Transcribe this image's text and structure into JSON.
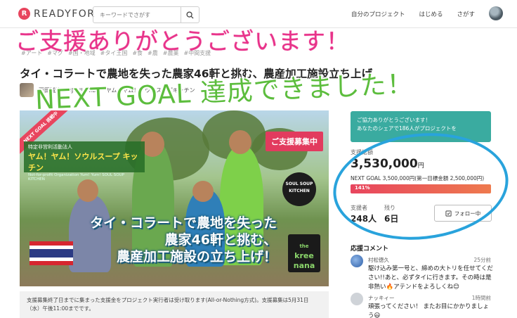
{
  "header": {
    "logo_mark": "R",
    "logo_text": "READYFOR",
    "search_placeholder": "キーワードでさがす",
    "nav_my_projects": "自分のプロジェクト",
    "nav_start": "はじめる",
    "nav_explore": "さがす"
  },
  "tags": [
    "#アート",
    "#マグ",
    "#国・地域",
    "#タイ王国",
    "#食",
    "#農",
    "#農業",
    "#中間支援"
  ],
  "project": {
    "title": "タイ・コラートで農地を失った農家46軒と挑む、農産加工施設立ち上げ",
    "owner": "西田誠治 SEIJI NISHIDA・ヤム！ヤム！ソウルスープキッチン"
  },
  "hero": {
    "ribbon": "NEXT GOAL 挑戦中",
    "org_line1": "特定非営利活動法人",
    "org_line2": "ヤム！ヤム！ソウルスープ キッチン",
    "org_line3": "Not-for-profit Organization Yum! Yum! SOUL SOUP KITCHEN",
    "recruit_badge": "ご支援募集中",
    "soul_badge": "SOUL SOUP KITCHEN",
    "kree_line1": "the",
    "kree_line2": "kree",
    "kree_line3": "nana",
    "caption_line1": "タイ・コラートで農地を失った",
    "caption_line2": "農家46軒と挑む、",
    "caption_line3": "農産加工施設の立ち上げ！"
  },
  "notice": "支援募集終了日までに集まった支援金をプロジェクト実行者は受け取ります(All-or-Nothing方式)。支援募集は5月31日（水）午後11:00までです。",
  "sidebar": {
    "thanks_line1": "ご協力ありがとうございます！",
    "thanks_line2": "あなたのシェアで186人がプロジェクトを",
    "funding_label": "支援総額",
    "amount": "3,530,000",
    "amount_unit": "円",
    "next_goal": "NEXT GOAL 3,500,000円(第一目標金額 2,500,000円)",
    "progress_label": "141%",
    "progress_fraction": 1.0,
    "supporters_label": "支援者",
    "supporters_value": "248人",
    "remaining_label": "残り",
    "remaining_value": "6日",
    "follow_button": "フォロー中"
  },
  "comments": {
    "title": "応援コメント",
    "items": [
      {
        "name": "村松徳久",
        "time": "25分前",
        "text": "駆け込み第一号と、締めの大トリを任せてください!!あと、必ずタイに行きます。その時は是非熱い🔥アテンドをよろしくね😊"
      },
      {
        "name": "ナッキィー",
        "time": "1時間前",
        "text": "頑張ってください！ またお目にかかりましょう😃"
      }
    ]
  },
  "overlays": {
    "thanks_big": "ご支援ありがとうございます！",
    "next_goal_big": "NEXT GOAL 達成できました！"
  },
  "colors": {
    "brand": "#e8455e",
    "thanks_box": "#3aaba0",
    "overlay_pink": "#e8338a",
    "overlay_green": "#5cbd3d",
    "highlight_circle": "#29a3dc"
  }
}
